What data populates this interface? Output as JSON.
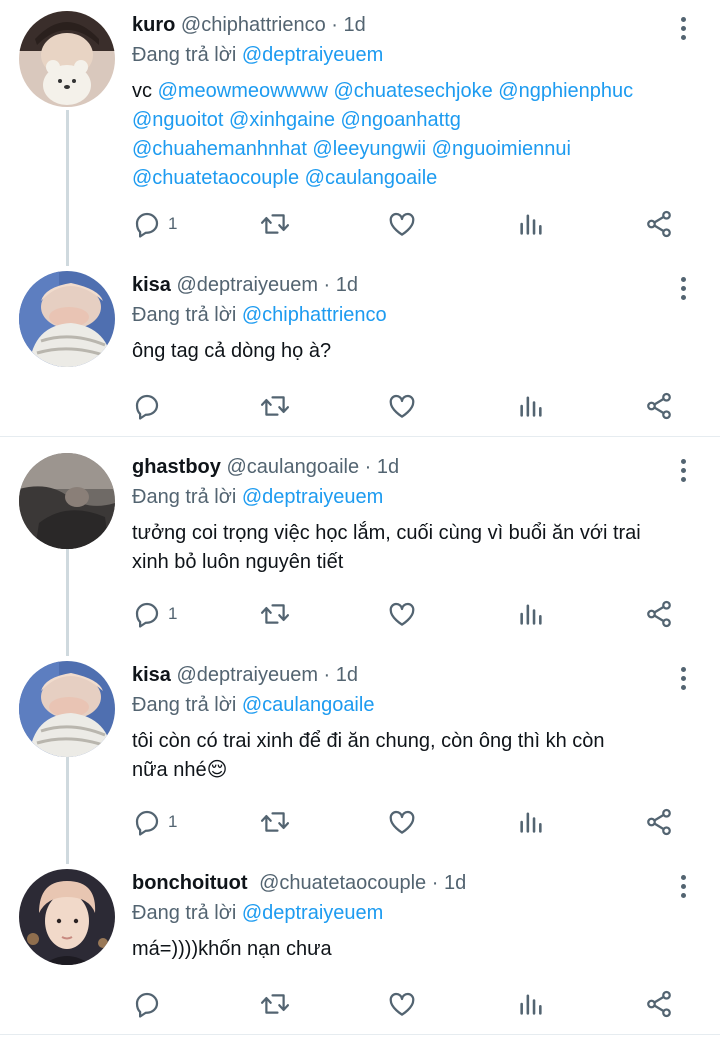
{
  "tweets": [
    {
      "name": "kuro",
      "handle": "@chiphattrienco",
      "time": "1d",
      "replying_prefix": "Đang trả lời ",
      "replying_to": "@deptraiyeuem",
      "text_prefix": "vc ",
      "mentions_line1": "@meowmeowwww @chuatesechjoke @ngphienphuc",
      "mentions_line2": "@nguoitot @xinhgaine @ngoanhattg",
      "mentions_line3": "@chuahemanhnhat @leeyungwii @nguoimiennui",
      "mentions_line4": "@chuatetaocouple @caulangoaile",
      "reply_count": "1",
      "separator": " · "
    },
    {
      "name": "kisa",
      "handle": "@deptraiyeuem",
      "time": "1d",
      "replying_prefix": "Đang trả lời ",
      "replying_to": "@chiphattrienco",
      "text": "ông tag cả dòng họ à?",
      "reply_count": "",
      "separator": " · "
    },
    {
      "name": "ghastboy",
      "handle": "@caulangoaile",
      "time": "1d",
      "replying_prefix": "Đang trả lời ",
      "replying_to": "@deptraiyeuem",
      "text_line1": "tưởng coi trọng việc học lắm, cuối cùng vì buổi ăn với trai",
      "text_line2": "xinh bỏ luôn nguyên tiết",
      "reply_count": "1",
      "separator": " · "
    },
    {
      "name": "kisa",
      "handle": "@deptraiyeuem",
      "time": "1d",
      "replying_prefix": "Đang trả lời ",
      "replying_to": "@caulangoaile",
      "text_line1": "tôi còn có trai xinh để đi ăn chung, còn ông thì kh còn",
      "text_line2": "nữa nhé",
      "emoji": "😌",
      "reply_count": "1",
      "separator": " · "
    },
    {
      "name": "bonchoituot",
      "handle": "@chuatetaocouple",
      "time": "1d",
      "replying_prefix": "Đang trả lời ",
      "replying_to": "@deptraiyeuem",
      "text": "má=))))khốn nạn chưa",
      "reply_count": "",
      "separator": " · "
    }
  ],
  "icons": {
    "reply": "reply-icon",
    "retweet": "retweet-icon",
    "like": "heart-icon",
    "analytics": "analytics-icon",
    "share": "share-icon",
    "more": "more-icon"
  },
  "colors": {
    "accent": "#1d9bf0",
    "secondary_text": "#536471",
    "thread_line": "#cfd9de",
    "separator": "#e6ecf0"
  }
}
